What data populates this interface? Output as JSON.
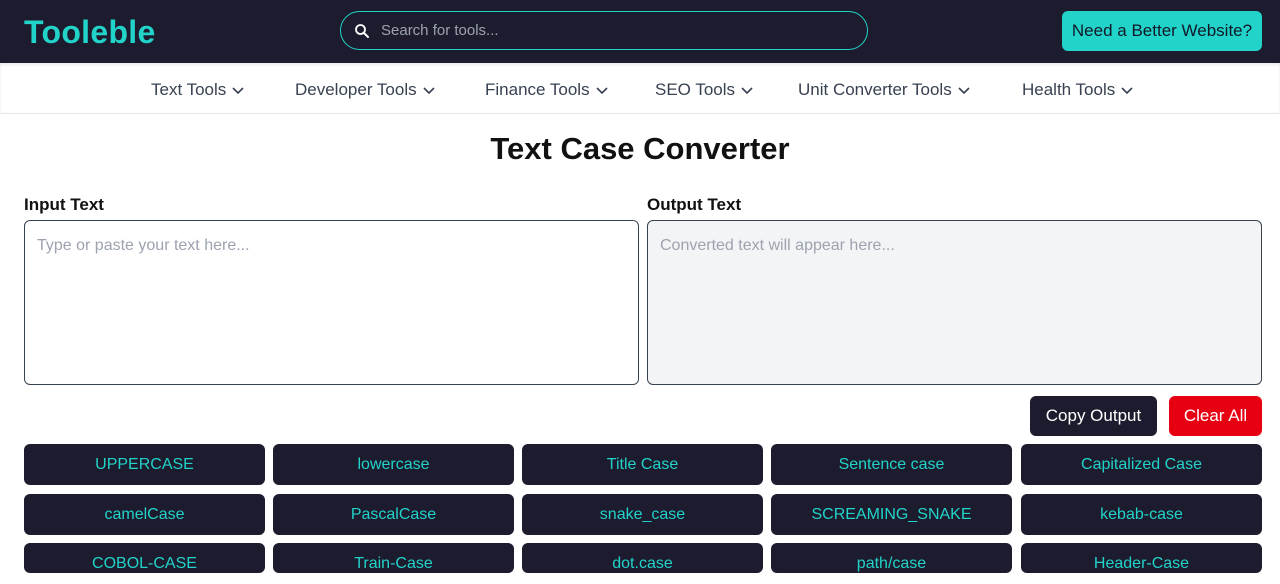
{
  "header": {
    "logo": "Tooleble",
    "search_placeholder": "Search for tools...",
    "cta_label": "Need a Better Website?",
    "colors": {
      "bar": "#1c1c2e",
      "accent": "#22d3c9"
    }
  },
  "nav": {
    "items": [
      {
        "label": "Text Tools"
      },
      {
        "label": "Developer Tools"
      },
      {
        "label": "Finance Tools"
      },
      {
        "label": "SEO Tools"
      },
      {
        "label": "Unit Converter Tools"
      },
      {
        "label": "Health Tools"
      }
    ]
  },
  "main": {
    "title": "Text Case Converter",
    "input_label": "Input Text",
    "input_placeholder": "Type or paste your text here...",
    "input_value": "",
    "output_label": "Output Text",
    "output_placeholder": "Converted text will appear here...",
    "output_value": "",
    "copy_label": "Copy Output",
    "clear_label": "Clear All",
    "clear_color": "#e60012"
  },
  "cases": [
    "UPPERCASE",
    "lowercase",
    "Title Case",
    "Sentence case",
    "Capitalized Case",
    "camelCase",
    "PascalCase",
    "snake_case",
    "SCREAMING_SNAKE",
    "kebab-case",
    "COBOL-CASE",
    "Train-Case",
    "dot.case",
    "path/case",
    "Header-Case"
  ]
}
